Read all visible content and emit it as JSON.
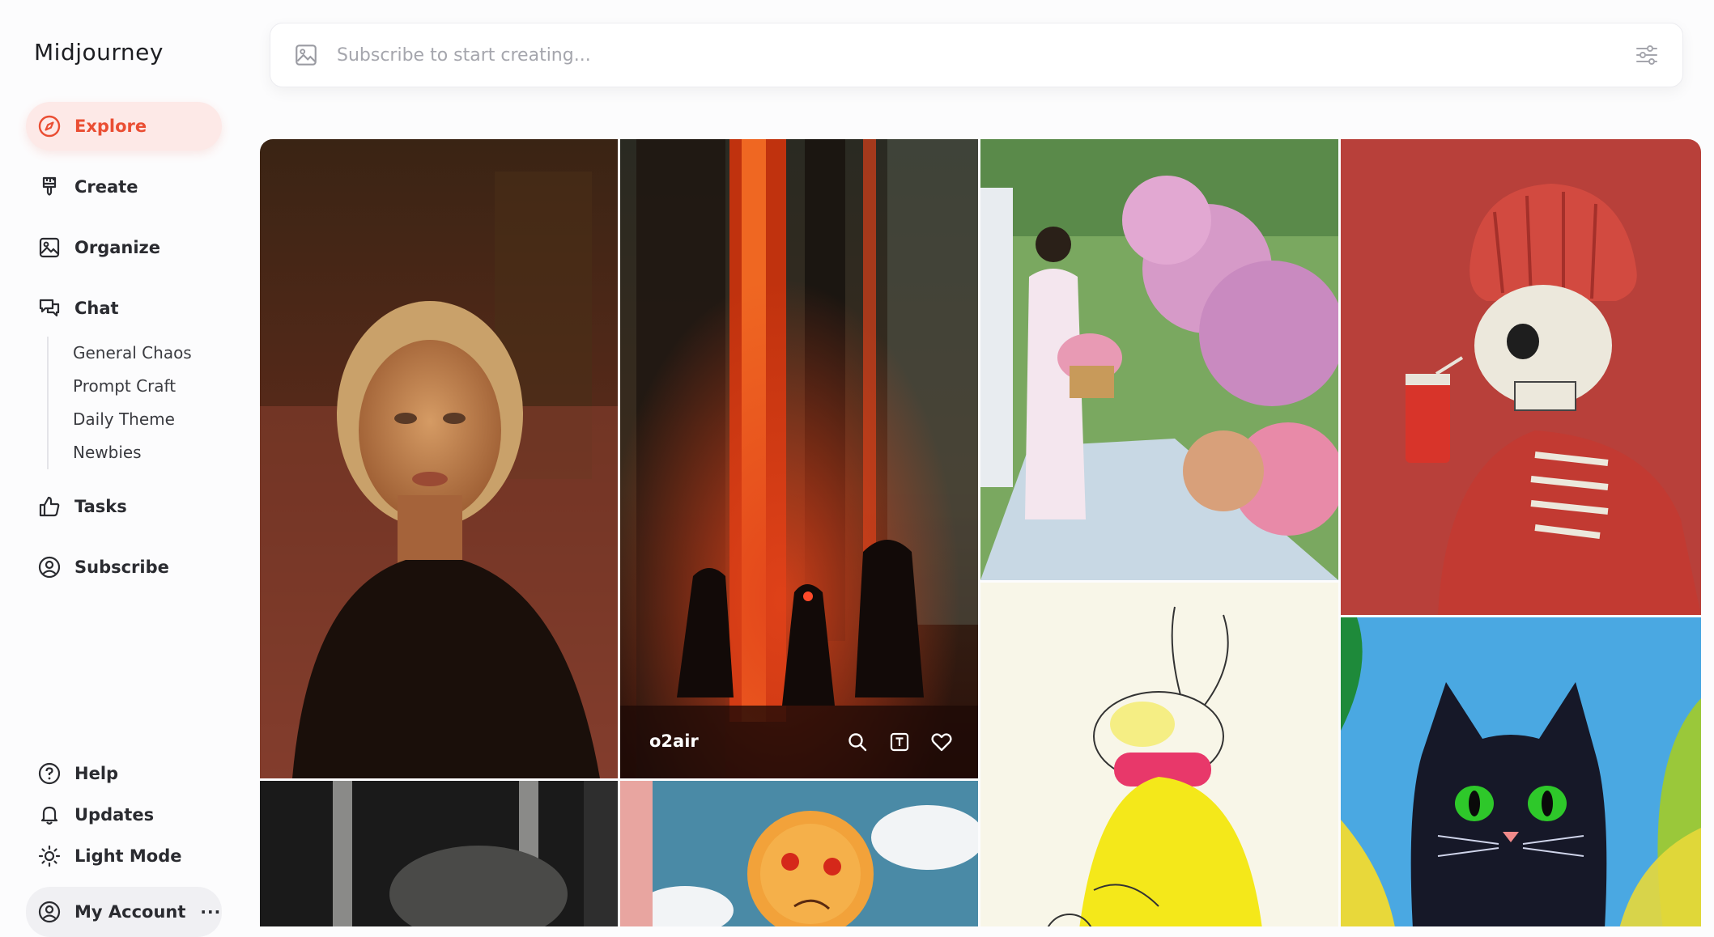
{
  "app": {
    "name": "Midjourney"
  },
  "nav": {
    "explore": "Explore",
    "create": "Create",
    "organize": "Organize",
    "chat": "Chat",
    "chat_rooms": [
      "General Chaos",
      "Prompt Craft",
      "Daily Theme",
      "Newbies"
    ],
    "tasks": "Tasks",
    "subscribe": "Subscribe"
  },
  "bottom": {
    "help": "Help",
    "updates": "Updates",
    "light_mode": "Light Mode",
    "account": "My Account",
    "account_more": "···"
  },
  "search": {
    "placeholder": "Subscribe to start creating..."
  },
  "gallery": {
    "hover_user": "o2air"
  },
  "colors": {
    "accent": "#ea4e33",
    "accent_bg": "#fde9e7"
  }
}
